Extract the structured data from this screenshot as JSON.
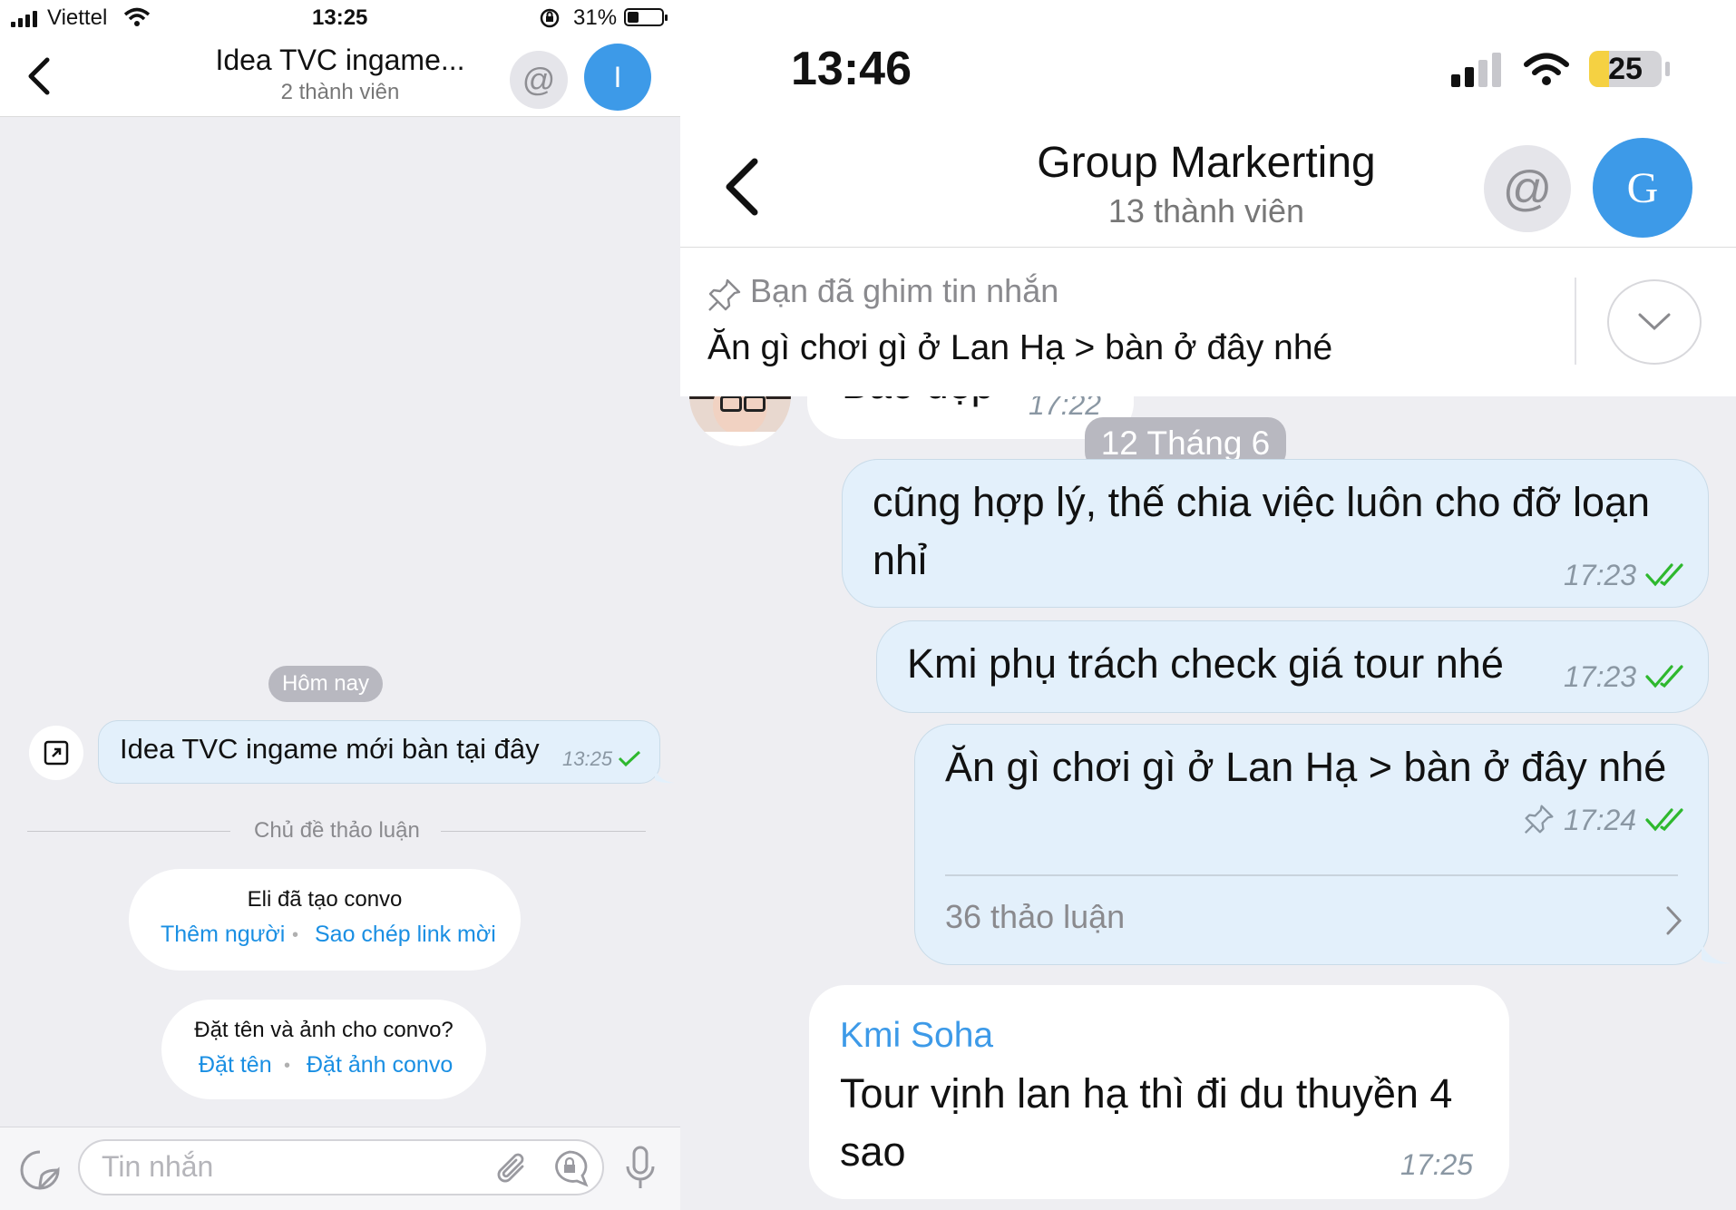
{
  "left": {
    "status": {
      "carrier": "Viettel",
      "time": "13:25",
      "battery": "31%"
    },
    "header": {
      "back_icon": "chevron-left-icon",
      "title": "Idea TVC ingame...",
      "subtitle": "2 thành viên",
      "mention_symbol": "@",
      "avatar_letter": "I",
      "avatar_color": "#3d9ae8"
    },
    "date_separator": "Hôm nay",
    "message": {
      "text": "Idea TVC ingame mới bàn tại đây",
      "time": "13:25"
    },
    "topic_divider": "Chủ đề thảo luận",
    "created_card": {
      "text": "Eli đã tạo convo",
      "link_add": "Thêm người",
      "link_copy": "Sao chép link mời"
    },
    "name_card": {
      "text": "Đặt tên và ảnh cho convo?",
      "link_name": "Đặt tên",
      "link_photo": "Đặt ảnh convo"
    },
    "input": {
      "placeholder": "Tin nhắn"
    }
  },
  "right": {
    "status": {
      "time": "13:46",
      "battery": "25",
      "battery_color": "#f5d142"
    },
    "header": {
      "title": "Group Markerting",
      "subtitle": "13 thành viên",
      "mention_symbol": "@",
      "avatar_letter": "G",
      "avatar_color": "#3d9ae8"
    },
    "pinned": {
      "label": "Bạn đã ghim tin nhắn",
      "text": "Ăn gì chơi gì ở Lan Hạ > bàn ở đây nhé"
    },
    "partial_message": {
      "text": "Bao đẹp",
      "time": "17:22"
    },
    "date_separator": "12 Tháng 6",
    "messages": [
      {
        "text": "cũng hợp lý, thế chia việc luôn cho đỡ loạn nhỉ",
        "time": "17:23"
      },
      {
        "text": "Kmi phụ trách check giá tour nhé",
        "time": "17:23"
      },
      {
        "text": "Ăn gì chơi gì ở Lan Hạ > bàn ở đây nhé",
        "time": "17:24",
        "discussion": "36 thảo luận"
      }
    ],
    "incoming": {
      "sender": "Kmi Soha",
      "text": "Tour vịnh lan hạ thì đi du thuyền 4 sao",
      "time": "17:25",
      "sender_color": "#3d9ae8"
    },
    "accent": "#3d9ae8",
    "bubble_color": "#e3f0fb",
    "check_color": "#2eb82e"
  }
}
